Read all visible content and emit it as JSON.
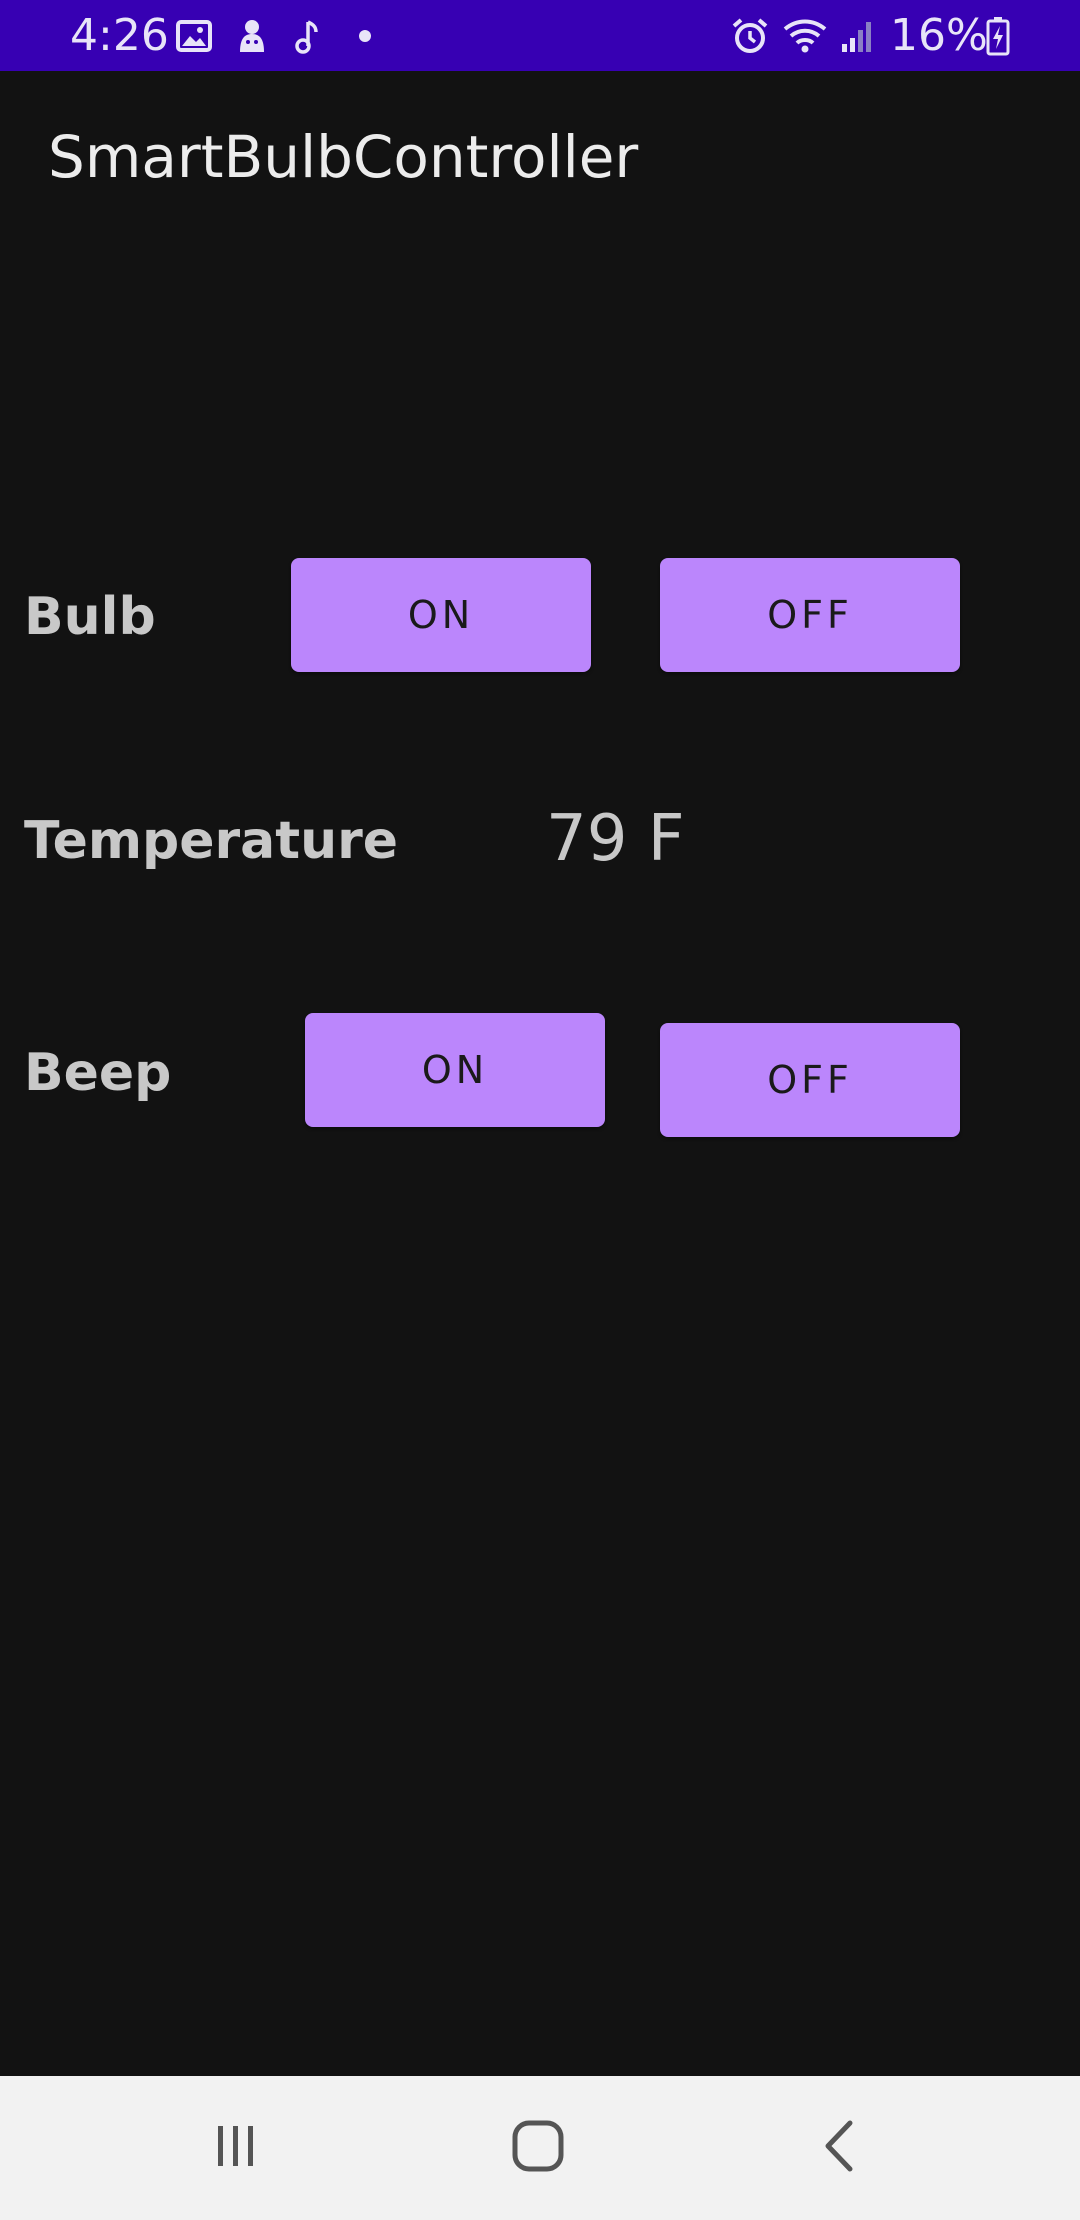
{
  "status_bar": {
    "time": "4:26",
    "battery": "16%",
    "color": "#3700b3",
    "left_icons": [
      "image-icon",
      "ghost-icon",
      "music-note-icon",
      "dot-icon"
    ],
    "right_icons": [
      "alarm-icon",
      "wifi-icon",
      "signal-icon",
      "battery-charging-icon"
    ]
  },
  "app": {
    "title": "SmartBulbController"
  },
  "bulb": {
    "label": "Bulb",
    "on_label": "ON",
    "off_label": "OFF"
  },
  "temperature": {
    "label": "Temperature",
    "value": "79 F"
  },
  "beep": {
    "label": "Beep",
    "on_label": "ON",
    "off_label": "OFF"
  },
  "colors": {
    "background": "#121212",
    "button": "#bb86fc",
    "nav_bar": "#f2f2f2"
  },
  "nav_bar": {
    "icons": [
      "recent-apps-icon",
      "home-icon",
      "back-icon"
    ]
  }
}
